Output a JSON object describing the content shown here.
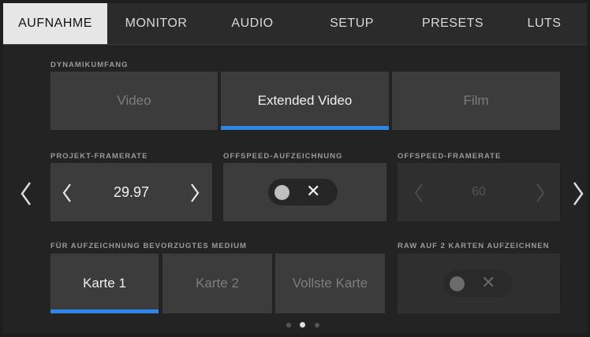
{
  "tabs": [
    "AUFNAHME",
    "MONITOR",
    "AUDIO",
    "SETUP",
    "PRESETS",
    "LUTS"
  ],
  "dynamic_range": {
    "label": "DYNAMIKUMFANG",
    "options": [
      "Video",
      "Extended Video",
      "Film"
    ],
    "selected": "Extended Video"
  },
  "project_framerate": {
    "label": "PROJEKT-FRAMERATE",
    "value": "29.97"
  },
  "offspeed_recording": {
    "label": "OFFSPEED-AUFZEICHNUNG",
    "toggle_symbol": "✕",
    "state": "off"
  },
  "offspeed_framerate": {
    "label": "OFFSPEED-FRAMERATE",
    "value": "60",
    "enabled": false
  },
  "preferred_media": {
    "label": "FÜR AUFZEICHNUNG BEVORZUGTES MEDIUM",
    "options": [
      "Karte 1",
      "Karte 2",
      "Vollste Karte"
    ],
    "selected": "Karte 1"
  },
  "raw_two_cards": {
    "label": "RAW AUF 2 KARTEN AUFZEICHNEN",
    "toggle_symbol": "✕",
    "state": "off",
    "enabled": false
  },
  "pager": {
    "pages": 3,
    "current": 2
  },
  "colors": {
    "accent": "#2e86e6",
    "tile": "#3c3c3c",
    "background": "#232323"
  },
  "icons": [
    "chevron-left-icon",
    "chevron-right-icon"
  ]
}
